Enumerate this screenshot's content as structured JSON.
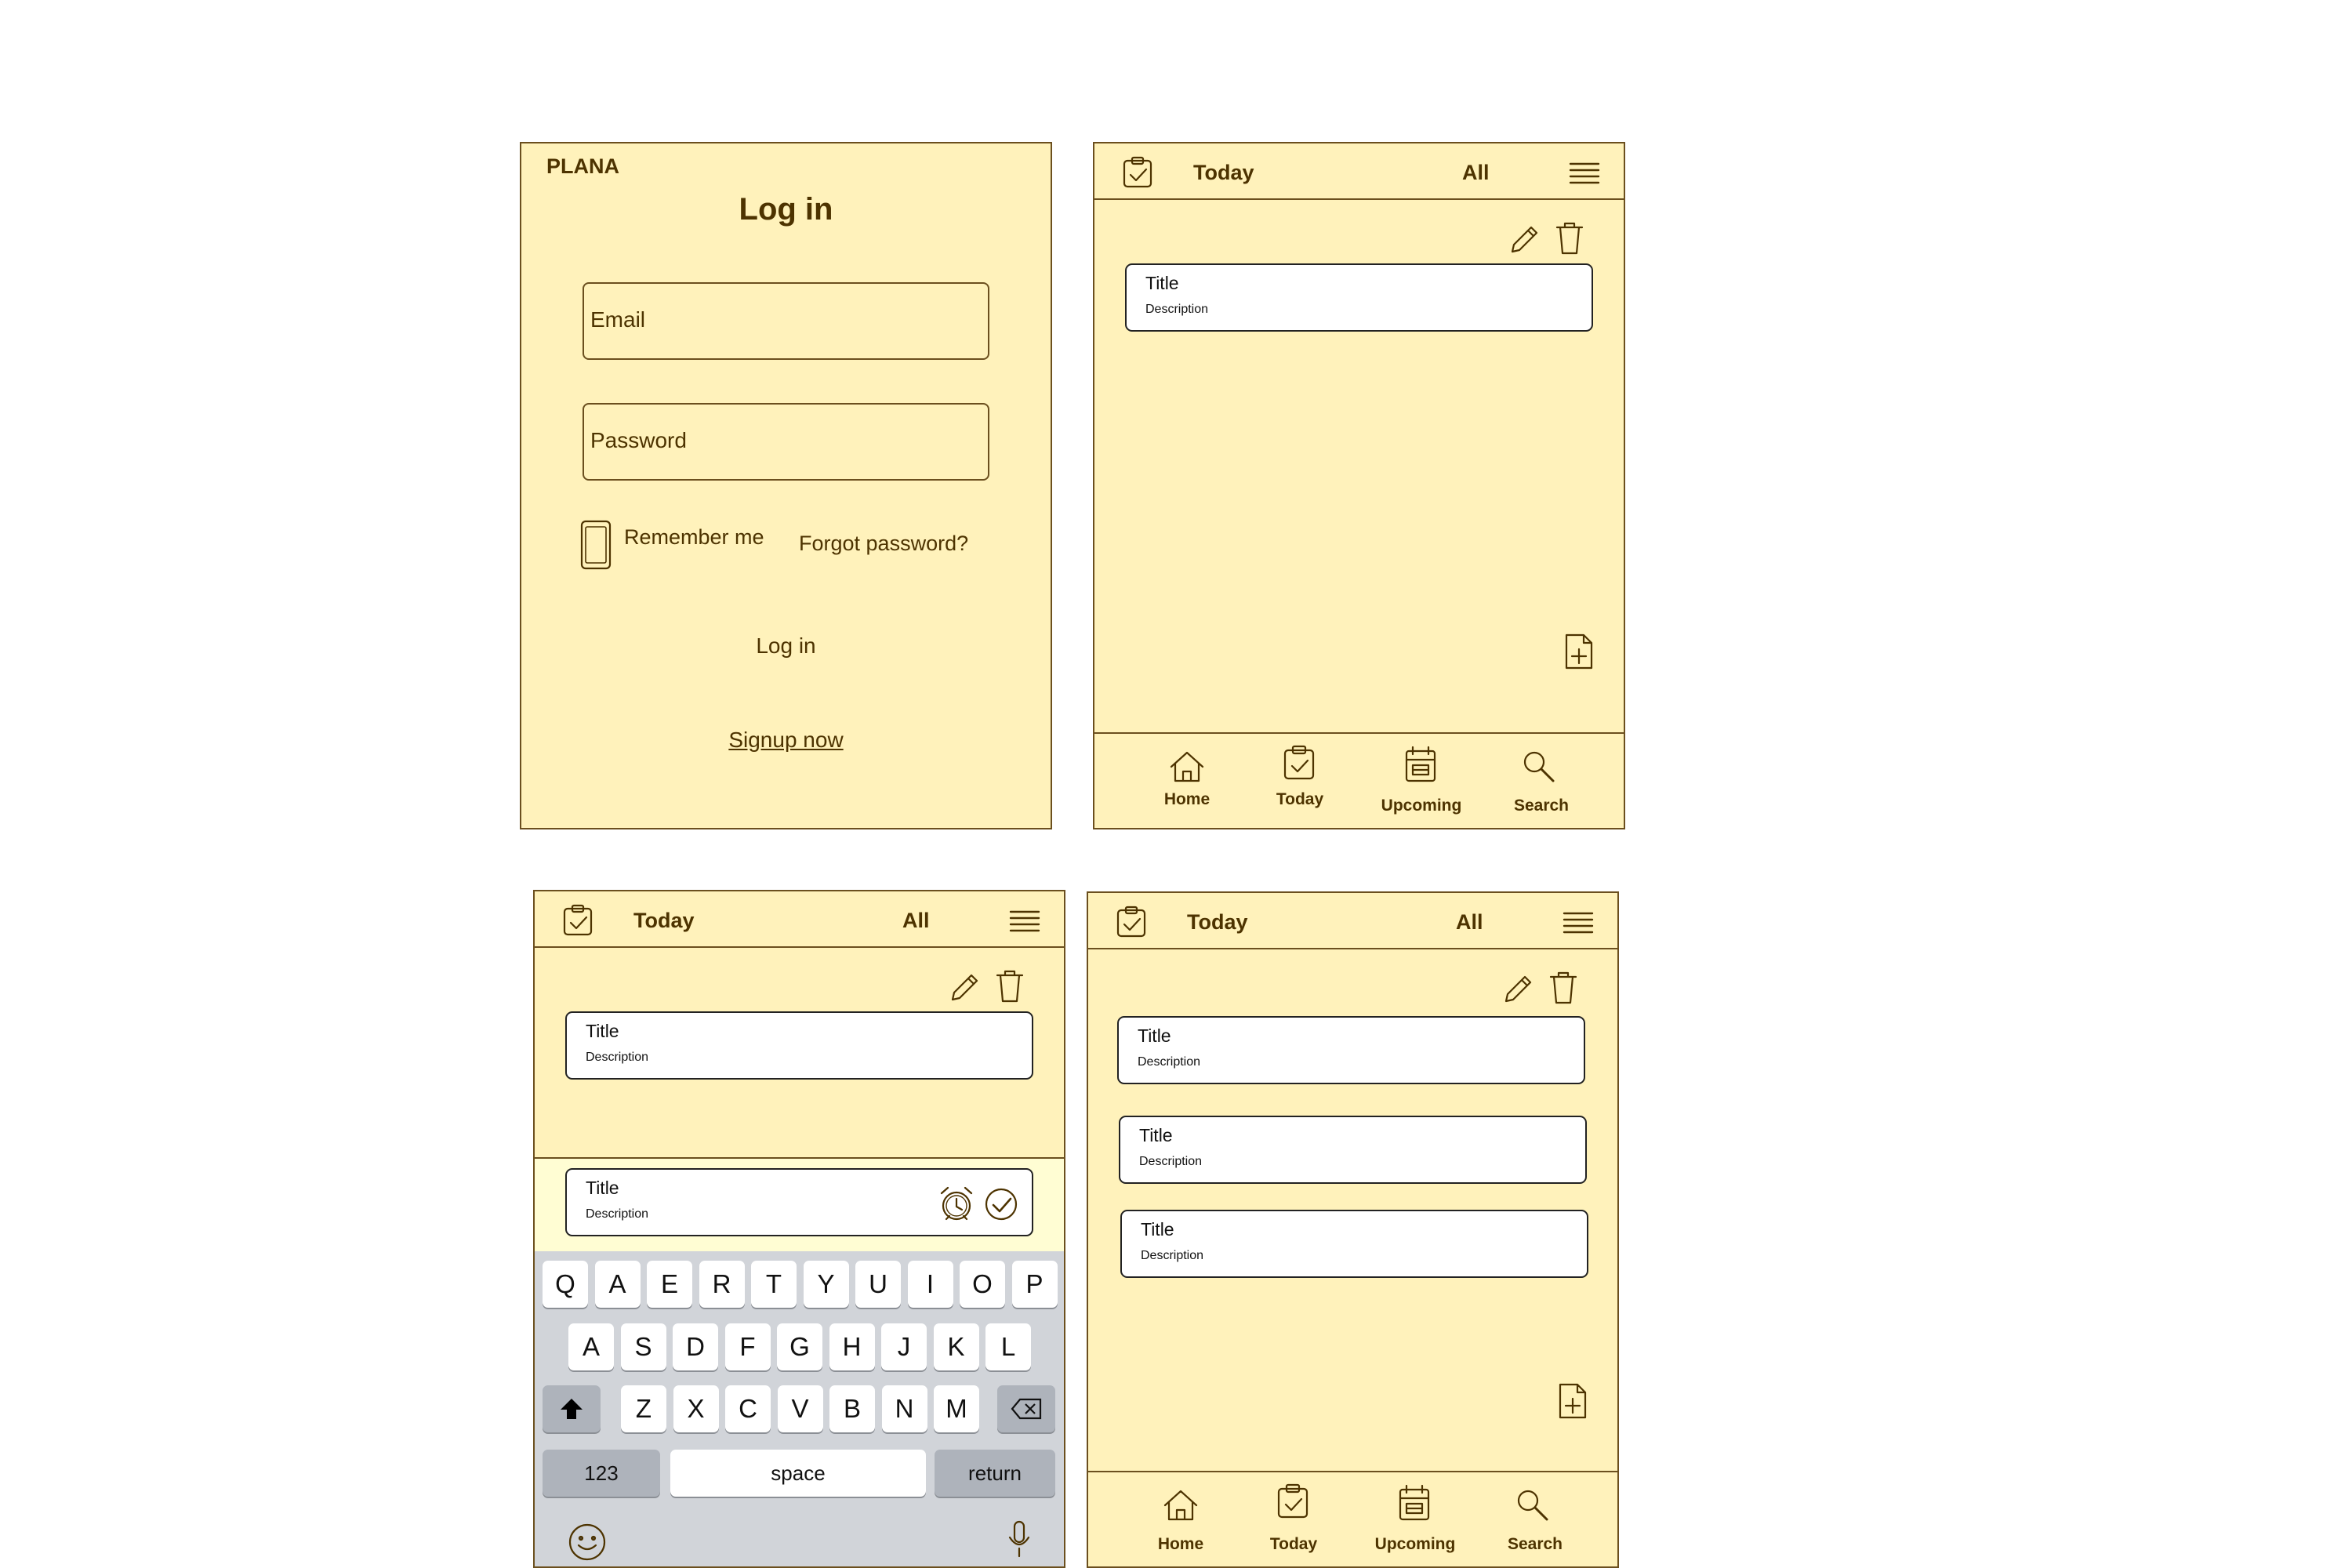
{
  "login": {
    "brand": "PLANA",
    "heading": "Log in",
    "email_placeholder": "Email",
    "password_placeholder": "Password",
    "remember_label": "Remember me",
    "forgot_label": "Forgot password?",
    "login_button": "Log in",
    "signup_link": "Signup now"
  },
  "topbar": {
    "title": "Today",
    "filter": "All"
  },
  "task_card": {
    "title": "Title",
    "description": "Description"
  },
  "nav": {
    "home": "Home",
    "today": "Today",
    "upcoming": "Upcoming",
    "search": "Search"
  },
  "keyboard": {
    "row1": [
      "Q",
      "A",
      "E",
      "R",
      "T",
      "Y",
      "U",
      "I",
      "O",
      "P"
    ],
    "row2": [
      "A",
      "S",
      "D",
      "F",
      "G",
      "H",
      "J",
      "K",
      "L"
    ],
    "row3": [
      "Z",
      "X",
      "C",
      "V",
      "B",
      "N",
      "M"
    ],
    "numbers": "123",
    "space": "space",
    "return": "return"
  },
  "colors": {
    "background": "#fff2bb",
    "border": "#6b4f1e",
    "text": "#4d3300",
    "keyboard": "#d1d4d9"
  }
}
